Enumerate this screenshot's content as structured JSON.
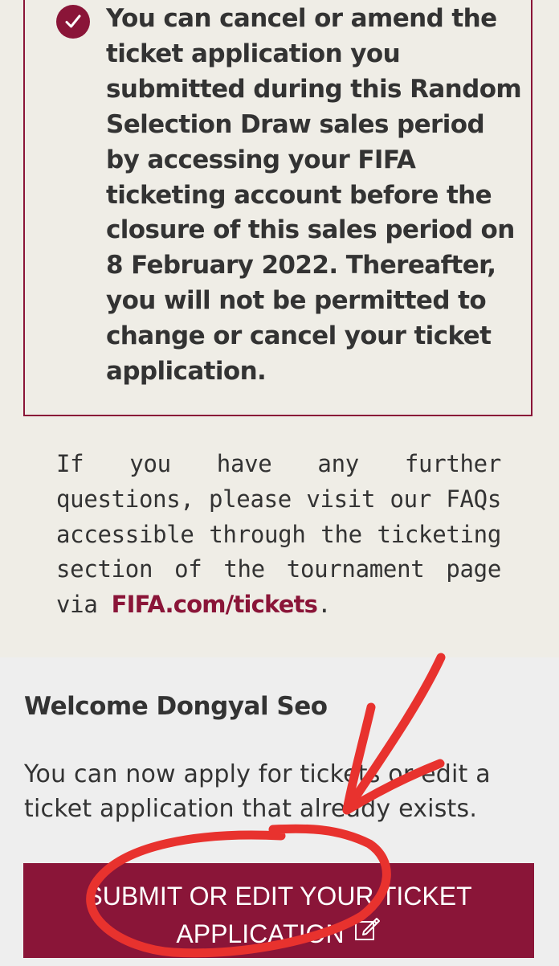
{
  "notice": {
    "text": "You can cancel or amend the ticket application you submitted during this Random Selection Draw sales period by accessing your FIFA ticketing account before the closure of this sales period on 8 February 2022. Thereafter, you will not be permitted to change or cancel your ticket application.",
    "icon": "checkmark-circle-icon"
  },
  "faq": {
    "text_before": "If you have any further questions, please visit our FAQs accessible through the ticketing section of the tournament page via ",
    "link_text": "FIFA.com/tickets",
    "text_after": "."
  },
  "welcome": {
    "title": "Welcome Dongyal Seo",
    "body": "You can now apply for tickets or edit a ticket application that already exists."
  },
  "submit_button": {
    "label": "SUBMIT OR EDIT YOUR TICKET APPLICATION",
    "icon": "edit-icon"
  },
  "colors": {
    "brand": "#8a1538",
    "annotation": "#e8322e",
    "background_top": "#efede6",
    "background_bottom": "#eeeeee"
  }
}
